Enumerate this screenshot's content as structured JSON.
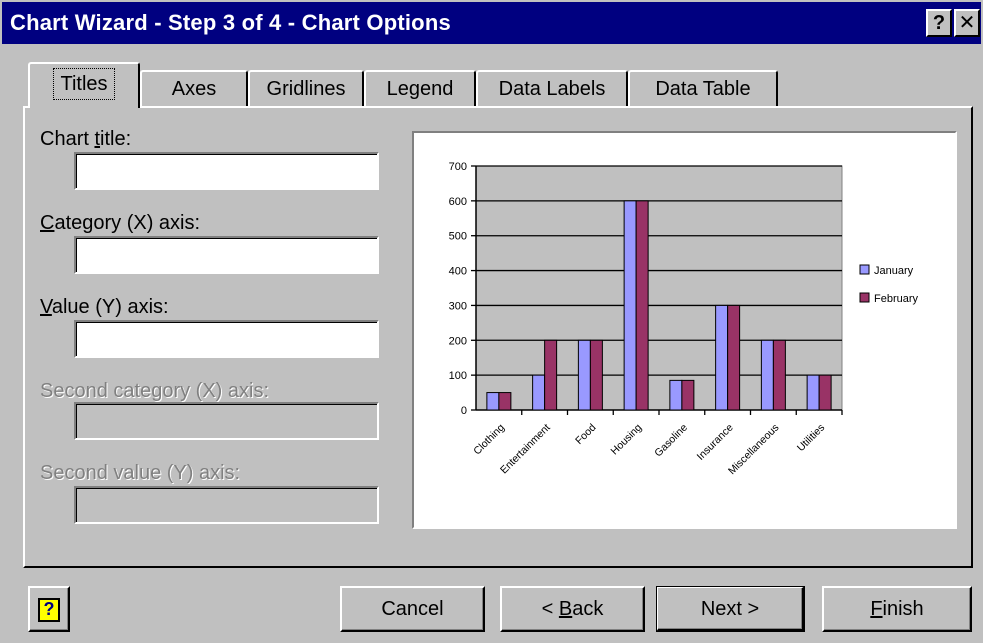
{
  "window": {
    "title": "Chart Wizard - Step 3 of 4 - Chart Options",
    "help_label": "?",
    "close_label": "✕"
  },
  "tabs": [
    {
      "label": "Titles",
      "active": true
    },
    {
      "label": "Axes"
    },
    {
      "label": "Gridlines"
    },
    {
      "label": "Legend"
    },
    {
      "label": "Data Labels"
    },
    {
      "label": "Data Table"
    }
  ],
  "fields": {
    "chart_title": {
      "label_mnemonic": "t",
      "label_before": "Chart ",
      "label_after": "itle:",
      "value": ""
    },
    "category_x": {
      "label_mnemonic": "C",
      "label_before": "",
      "label_after": "ategory (X) axis:",
      "value": ""
    },
    "value_y": {
      "label_mnemonic": "V",
      "label_before": "",
      "label_after": "alue (Y) axis:",
      "value": ""
    },
    "second_category_x": {
      "label": "Second category (X) axis:",
      "value": ""
    },
    "second_value_y": {
      "label": "Second value (Y) axis:",
      "value": ""
    }
  },
  "buttons": {
    "help_icon": "?",
    "cancel": "Cancel",
    "back_before": "< ",
    "back_mnemonic": "B",
    "back_after": "ack",
    "next": "Next >",
    "finish_mnemonic": "F",
    "finish_after": "inish"
  },
  "chart_data": {
    "type": "bar",
    "categories": [
      "Clothing",
      "Entertainment",
      "Food",
      "Housing",
      "Gasoline",
      "Insurance",
      "Miscellaneous",
      "Utilities"
    ],
    "series": [
      {
        "name": "January",
        "values": [
          50,
          100,
          200,
          600,
          85,
          300,
          200,
          100
        ],
        "color": "#9999ff"
      },
      {
        "name": "February",
        "values": [
          50,
          200,
          200,
          600,
          85,
          300,
          200,
          100
        ],
        "color": "#993366"
      }
    ],
    "yticks": [
      0,
      100,
      200,
      300,
      400,
      500,
      600,
      700
    ],
    "ylim": [
      0,
      700
    ],
    "plot_background": "#c0c0c0",
    "grid": true,
    "legend": "right"
  }
}
